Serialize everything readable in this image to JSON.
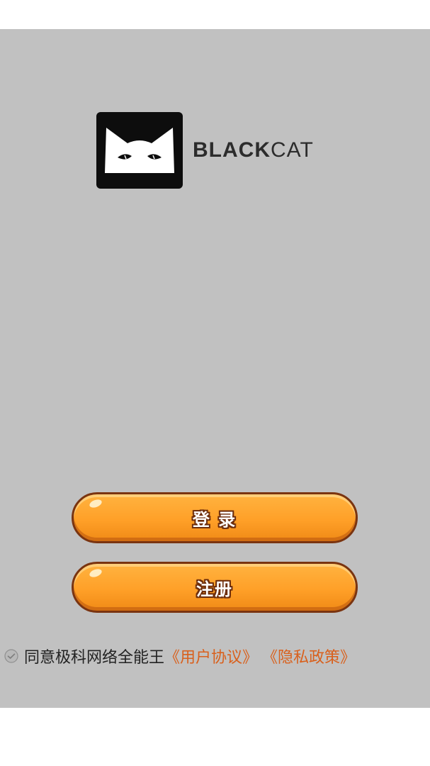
{
  "brand": {
    "logo_icon": "black-cat-icon",
    "name_bold": "BLACK",
    "name_light": "CAT"
  },
  "buttons": {
    "login_label": "登 录",
    "register_label": "注册"
  },
  "agreement": {
    "checkbox_icon": "check-circle-icon",
    "text": "同意极科网络全能王",
    "user_agreement": "《用户协议》",
    "privacy_policy": "《隐私政策》"
  },
  "colors": {
    "background": "#c1c1c1",
    "button_fill": "#ffa028",
    "button_border": "#7a3410",
    "link": "#d9601c"
  }
}
